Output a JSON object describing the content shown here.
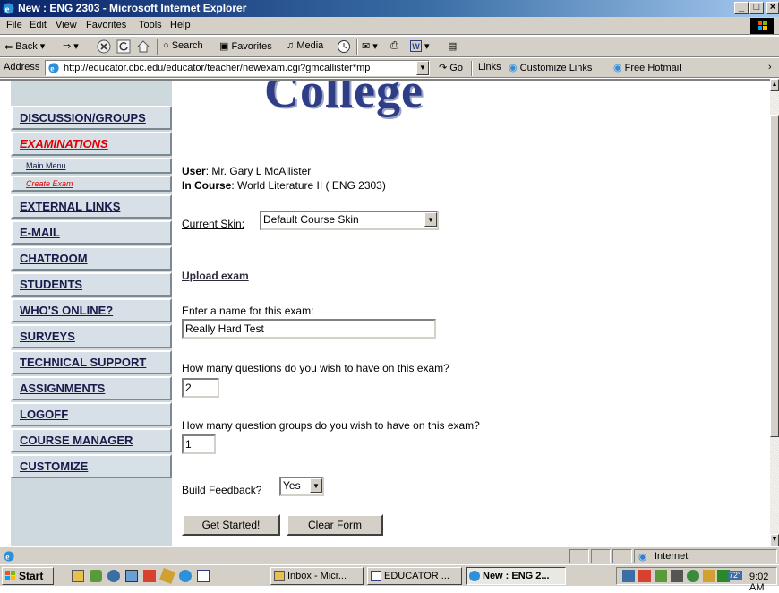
{
  "window": {
    "title": "New : ENG 2303 - Microsoft Internet Explorer",
    "min": "_",
    "max": "□",
    "close": "×"
  },
  "menu": [
    "File",
    "Edit",
    "View",
    "Favorites",
    "Tools",
    "Help"
  ],
  "toolbar": {
    "back": "Back",
    "search": "Search",
    "favorites": "Favorites",
    "media": "Media"
  },
  "address": {
    "label": "Address",
    "url": "http://educator.cbc.edu/educator/teacher/newexam.cgi?gmcallister*mp",
    "go": "Go",
    "links": "Links",
    "customize_links": "Customize Links",
    "free_hotmail": "Free Hotmail"
  },
  "header": {
    "college": "College"
  },
  "sidebar": {
    "items": [
      {
        "label": "DISCUSSION/GROUPS"
      },
      {
        "label": "EXAMINATIONS"
      },
      {
        "label": "Main Menu"
      },
      {
        "label": "Create Exam"
      },
      {
        "label": "EXTERNAL LINKS"
      },
      {
        "label": "E-MAIL"
      },
      {
        "label": "CHATROOM"
      },
      {
        "label": "STUDENTS"
      },
      {
        "label": "WHO'S ONLINE?"
      },
      {
        "label": "SURVEYS"
      },
      {
        "label": "TECHNICAL SUPPORT"
      },
      {
        "label": "ASSIGNMENTS"
      },
      {
        "label": "LOGOFF"
      },
      {
        "label": "COURSE MANAGER"
      },
      {
        "label": "CUSTOMIZE"
      }
    ]
  },
  "main": {
    "user_label": "User",
    "user_value": ": Mr. Gary L McAllister",
    "course_label": "In Course",
    "course_value": ": World Literature II ( ENG 2303)",
    "skin_label": "Current Skin:",
    "skin_value": "Default Course Skin",
    "upload_link": "Upload exam",
    "name_label": "Enter a name for this exam:",
    "name_value": "Really Hard Test",
    "questions_label": "How many questions do you wish to have on this exam?",
    "questions_value": "2",
    "groups_label": "How many question groups do you wish to have on this exam?",
    "groups_value": "1",
    "feedback_label": "Build Feedback?",
    "feedback_value": "Yes",
    "start_button": "Get Started!",
    "clear_button": "Clear Form"
  },
  "status": {
    "zone": "Internet"
  },
  "taskbar": {
    "start": "Start",
    "tasks": [
      {
        "label": "Inbox - Micr..."
      },
      {
        "label": "EDUCATOR ..."
      },
      {
        "label": "New : ENG 2..."
      }
    ],
    "clock": "9:02 AM",
    "weather": "72°"
  }
}
